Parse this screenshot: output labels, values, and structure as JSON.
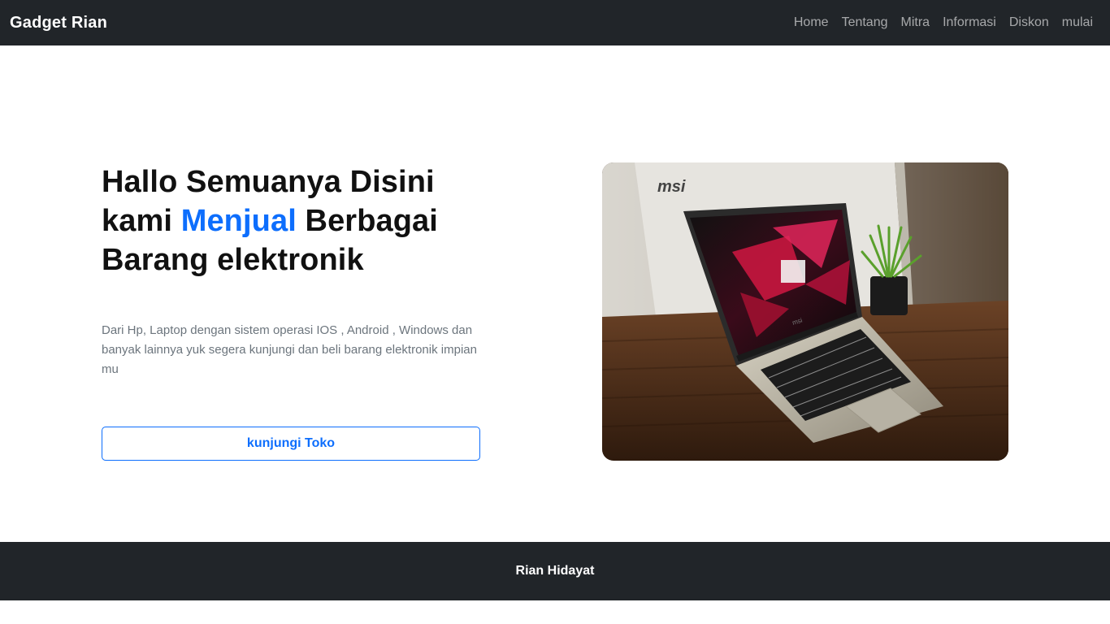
{
  "navbar": {
    "brand": "Gadget Rian",
    "links": [
      "Home",
      "Tentang",
      "Mitra",
      "Informasi",
      "Diskon",
      "mulai"
    ]
  },
  "hero": {
    "headline_line1": "Hallo Semuanya Disini",
    "headline_kami": "kami",
    "headline_accent": "Menjual",
    "headline_after_accent": "Berbagai",
    "headline_line3": "Barang elektronik",
    "description": "Dari Hp, Laptop dengan sistem operasi IOS , Android , Windows dan banyak lainnya yuk segera kunjungi dan beli barang elektronik impian mu",
    "button_label": "kunjungi Toko",
    "image_box_logo": "msi",
    "image_laptop_logo": "msi"
  },
  "footer": {
    "text": "Rian Hidayat"
  },
  "colors": {
    "navbar_bg": "#212529",
    "accent": "#0d6efd",
    "muted_text": "#6c757d"
  }
}
